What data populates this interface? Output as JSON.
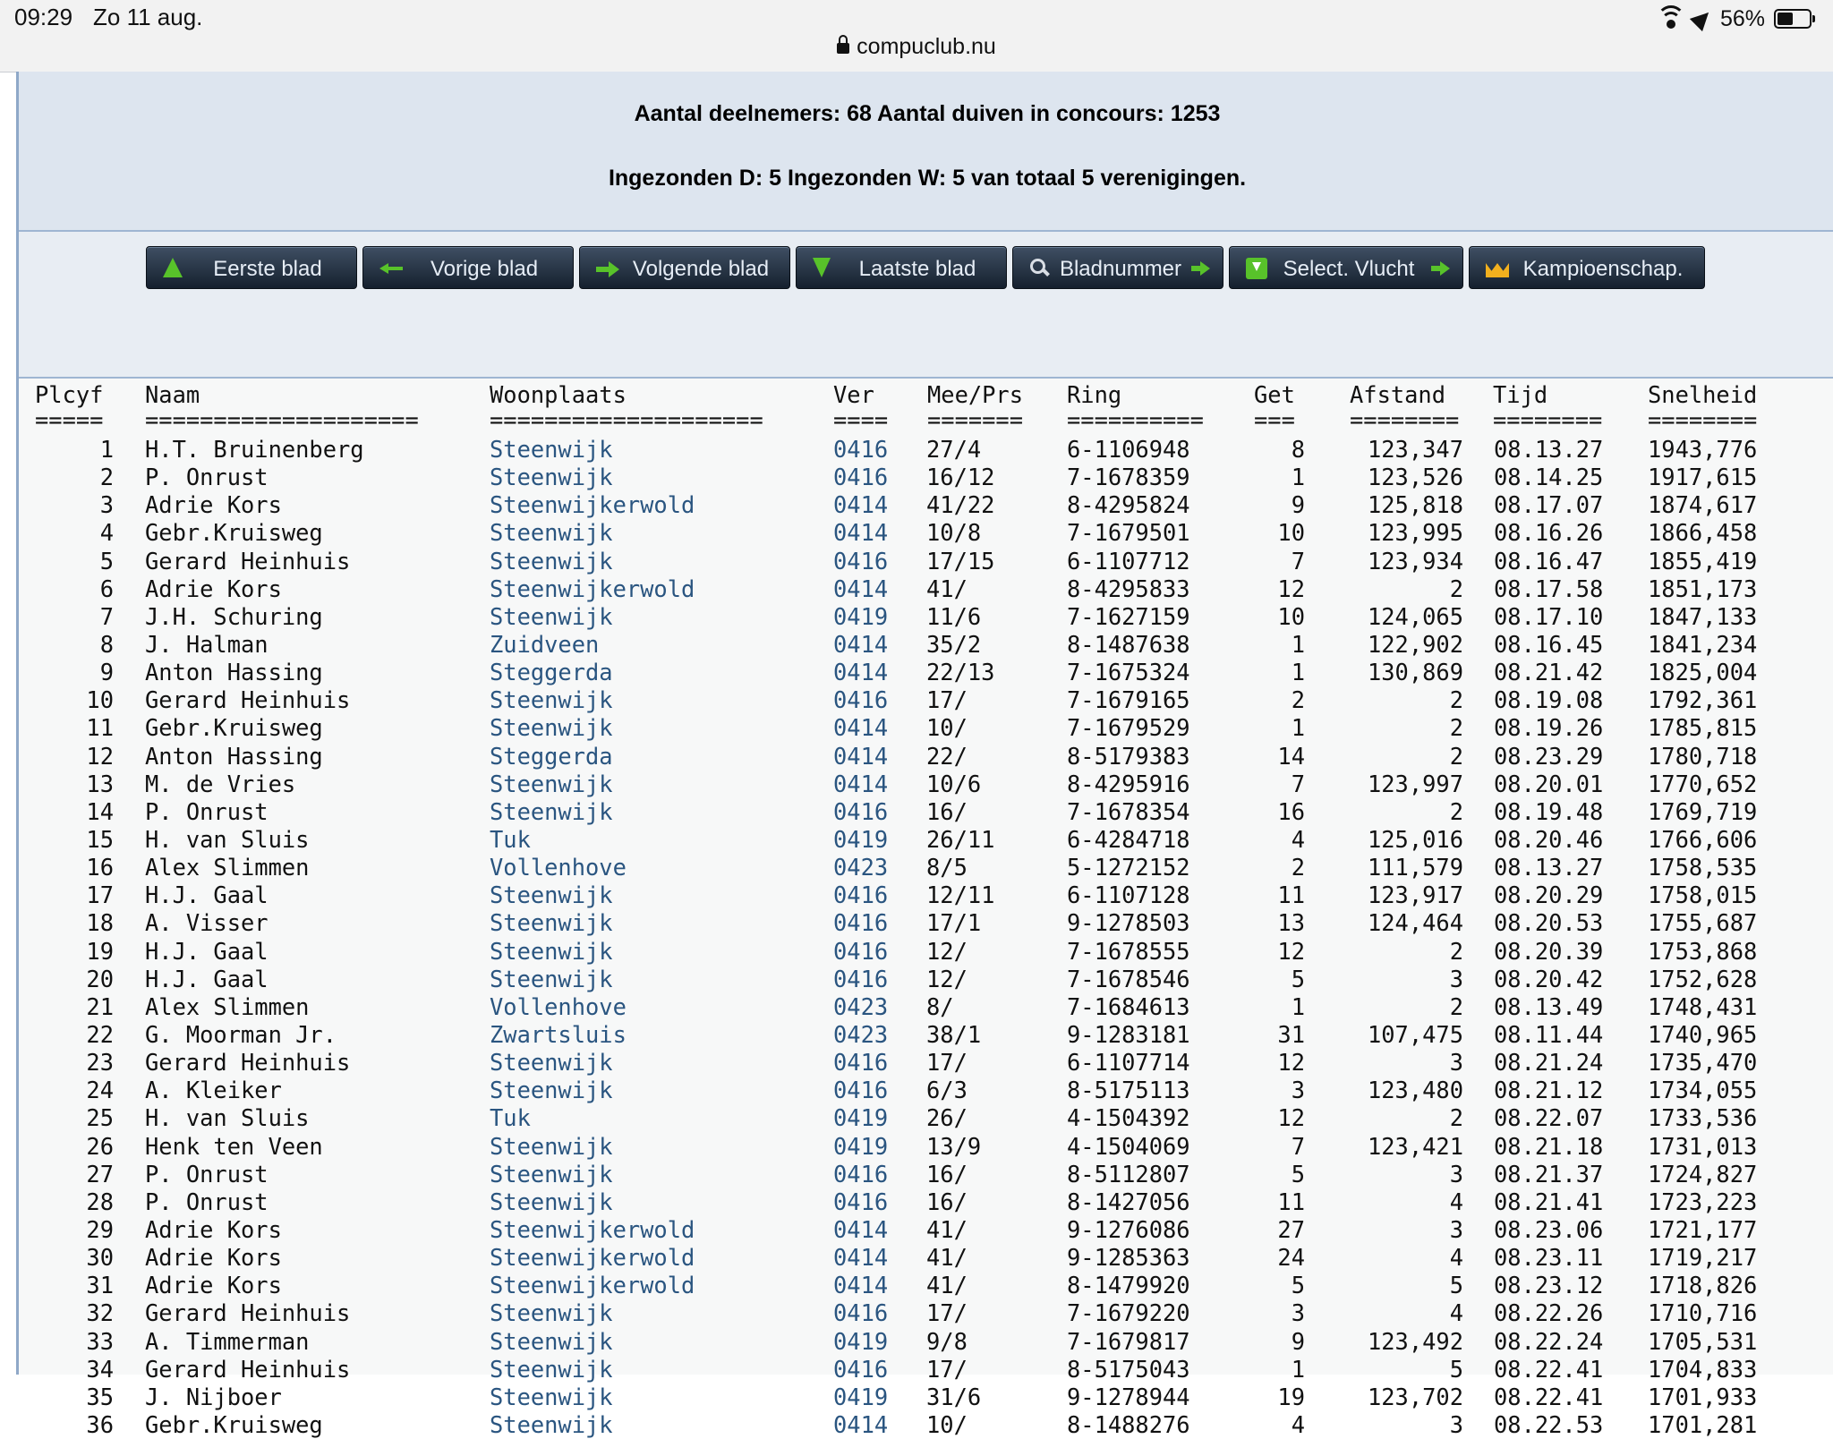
{
  "status_bar": {
    "time": "09:29",
    "date": "Zo 11 aug.",
    "url": "compuclub.nu",
    "battery": "56%",
    "battery_level": 0.56
  },
  "info": {
    "line1": "Aantal deelnemers: 68 Aantal duiven in concours: 1253",
    "line2": "Ingezonden D: 5 Ingezonden W: 5 van totaal 5 verenigingen."
  },
  "nav": {
    "buttons": [
      {
        "label": "Eerste blad",
        "icon": "arrow-up-icon"
      },
      {
        "label": "Vorige blad",
        "icon": "arrow-left-icon"
      },
      {
        "label": "Volgende blad",
        "icon": "arrow-right-icon"
      },
      {
        "label": "Laatste blad",
        "icon": "arrow-down-icon"
      },
      {
        "label": "Bladnummer",
        "icon": "search-icon"
      },
      {
        "label": "Select. Vlucht",
        "icon": "download-icon"
      },
      {
        "label": "Kampioenschap.",
        "icon": "crown-icon"
      }
    ]
  },
  "table": {
    "headers": [
      "Plcyf",
      "Naam",
      "Woonplaats",
      "Ver",
      "Mee/Prs",
      "Ring",
      "Get",
      "Afstand",
      "Tijd",
      "Snelheid"
    ],
    "separators": [
      "=====",
      "====================",
      "====================",
      "====",
      "=======",
      "==========",
      "===",
      "========",
      "========",
      "========"
    ],
    "rows": [
      [
        "1",
        "H.T. Bruinenberg",
        "Steenwijk",
        "0416",
        "27/4",
        "6-1106948",
        "8",
        "123,347",
        "08.13.27",
        "1943,776"
      ],
      [
        "2",
        "P. Onrust",
        "Steenwijk",
        "0416",
        "16/12",
        "7-1678359",
        "1",
        "123,526",
        "08.14.25",
        "1917,615"
      ],
      [
        "3",
        "Adrie Kors",
        "Steenwijkerwold",
        "0414",
        "41/22",
        "8-4295824",
        "9",
        "125,818",
        "08.17.07",
        "1874,617"
      ],
      [
        "4",
        "Gebr.Kruisweg",
        "Steenwijk",
        "0414",
        "10/8",
        "7-1679501",
        "10",
        "123,995",
        "08.16.26",
        "1866,458"
      ],
      [
        "5",
        "Gerard Heinhuis",
        "Steenwijk",
        "0416",
        "17/15",
        "6-1107712",
        "7",
        "123,934",
        "08.16.47",
        "1855,419"
      ],
      [
        "6",
        "Adrie Kors",
        "Steenwijkerwold",
        "0414",
        "41/",
        "8-4295833",
        "12",
        "2",
        "08.17.58",
        "1851,173"
      ],
      [
        "7",
        "J.H. Schuring",
        "Steenwijk",
        "0419",
        "11/6",
        "7-1627159",
        "10",
        "124,065",
        "08.17.10",
        "1847,133"
      ],
      [
        "8",
        "J. Halman",
        "Zuidveen",
        "0414",
        "35/2",
        "8-1487638",
        "1",
        "122,902",
        "08.16.45",
        "1841,234"
      ],
      [
        "9",
        "Anton Hassing",
        "Steggerda",
        "0414",
        "22/13",
        "7-1675324",
        "1",
        "130,869",
        "08.21.42",
        "1825,004"
      ],
      [
        "10",
        "Gerard Heinhuis",
        "Steenwijk",
        "0416",
        "17/",
        "7-1679165",
        "2",
        "2",
        "08.19.08",
        "1792,361"
      ],
      [
        "11",
        "Gebr.Kruisweg",
        "Steenwijk",
        "0414",
        "10/",
        "7-1679529",
        "1",
        "2",
        "08.19.26",
        "1785,815"
      ],
      [
        "12",
        "Anton Hassing",
        "Steggerda",
        "0414",
        "22/",
        "8-5179383",
        "14",
        "2",
        "08.23.29",
        "1780,718"
      ],
      [
        "13",
        "M. de Vries",
        "Steenwijk",
        "0414",
        "10/6",
        "8-4295916",
        "7",
        "123,997",
        "08.20.01",
        "1770,652"
      ],
      [
        "14",
        "P. Onrust",
        "Steenwijk",
        "0416",
        "16/",
        "7-1678354",
        "16",
        "2",
        "08.19.48",
        "1769,719"
      ],
      [
        "15",
        "H. van Sluis",
        "Tuk",
        "0419",
        "26/11",
        "6-4284718",
        "4",
        "125,016",
        "08.20.46",
        "1766,606"
      ],
      [
        "16",
        "Alex Slimmen",
        "Vollenhove",
        "0423",
        "8/5",
        "5-1272152",
        "2",
        "111,579",
        "08.13.27",
        "1758,535"
      ],
      [
        "17",
        "H.J. Gaal",
        "Steenwijk",
        "0416",
        "12/11",
        "6-1107128",
        "11",
        "123,917",
        "08.20.29",
        "1758,015"
      ],
      [
        "18",
        "A. Visser",
        "Steenwijk",
        "0416",
        "17/1",
        "9-1278503",
        "13",
        "124,464",
        "08.20.53",
        "1755,687"
      ],
      [
        "19",
        "H.J. Gaal",
        "Steenwijk",
        "0416",
        "12/",
        "7-1678555",
        "12",
        "2",
        "08.20.39",
        "1753,868"
      ],
      [
        "20",
        "H.J. Gaal",
        "Steenwijk",
        "0416",
        "12/",
        "7-1678546",
        "5",
        "3",
        "08.20.42",
        "1752,628"
      ],
      [
        "21",
        "Alex Slimmen",
        "Vollenhove",
        "0423",
        "8/",
        "7-1684613",
        "1",
        "2",
        "08.13.49",
        "1748,431"
      ],
      [
        "22",
        "G. Moorman Jr.",
        "Zwartsluis",
        "0423",
        "38/1",
        "9-1283181",
        "31",
        "107,475",
        "08.11.44",
        "1740,965"
      ],
      [
        "23",
        "Gerard Heinhuis",
        "Steenwijk",
        "0416",
        "17/",
        "6-1107714",
        "12",
        "3",
        "08.21.24",
        "1735,470"
      ],
      [
        "24",
        "A. Kleiker",
        "Steenwijk",
        "0416",
        "6/3",
        "8-5175113",
        "3",
        "123,480",
        "08.21.12",
        "1734,055"
      ],
      [
        "25",
        "H. van Sluis",
        "Tuk",
        "0419",
        "26/",
        "4-1504392",
        "12",
        "2",
        "08.22.07",
        "1733,536"
      ],
      [
        "26",
        "Henk ten Veen",
        "Steenwijk",
        "0419",
        "13/9",
        "4-1504069",
        "7",
        "123,421",
        "08.21.18",
        "1731,013"
      ],
      [
        "27",
        "P. Onrust",
        "Steenwijk",
        "0416",
        "16/",
        "8-5112807",
        "5",
        "3",
        "08.21.37",
        "1724,827"
      ],
      [
        "28",
        "P. Onrust",
        "Steenwijk",
        "0416",
        "16/",
        "8-1427056",
        "11",
        "4",
        "08.21.41",
        "1723,223"
      ],
      [
        "29",
        "Adrie Kors",
        "Steenwijkerwold",
        "0414",
        "41/",
        "9-1276086",
        "27",
        "3",
        "08.23.06",
        "1721,177"
      ],
      [
        "30",
        "Adrie Kors",
        "Steenwijkerwold",
        "0414",
        "41/",
        "9-1285363",
        "24",
        "4",
        "08.23.11",
        "1719,217"
      ],
      [
        "31",
        "Adrie Kors",
        "Steenwijkerwold",
        "0414",
        "41/",
        "8-1479920",
        "5",
        "5",
        "08.23.12",
        "1718,826"
      ],
      [
        "32",
        "Gerard Heinhuis",
        "Steenwijk",
        "0416",
        "17/",
        "7-1679220",
        "3",
        "4",
        "08.22.26",
        "1710,716"
      ],
      [
        "33",
        "A. Timmerman",
        "Steenwijk",
        "0419",
        "9/8",
        "7-1679817",
        "9",
        "123,492",
        "08.22.24",
        "1705,531"
      ],
      [
        "34",
        "Gerard Heinhuis",
        "Steenwijk",
        "0416",
        "17/",
        "8-5175043",
        "1",
        "5",
        "08.22.41",
        "1704,833"
      ],
      [
        "35",
        "J. Nijboer",
        "Steenwijk",
        "0419",
        "31/6",
        "9-1278944",
        "19",
        "123,702",
        "08.22.41",
        "1701,933"
      ],
      [
        "36",
        "Gebr.Kruisweg",
        "Steenwijk",
        "0414",
        "10/",
        "8-1488276",
        "4",
        "3",
        "08.22.53",
        "1701,281"
      ]
    ]
  }
}
